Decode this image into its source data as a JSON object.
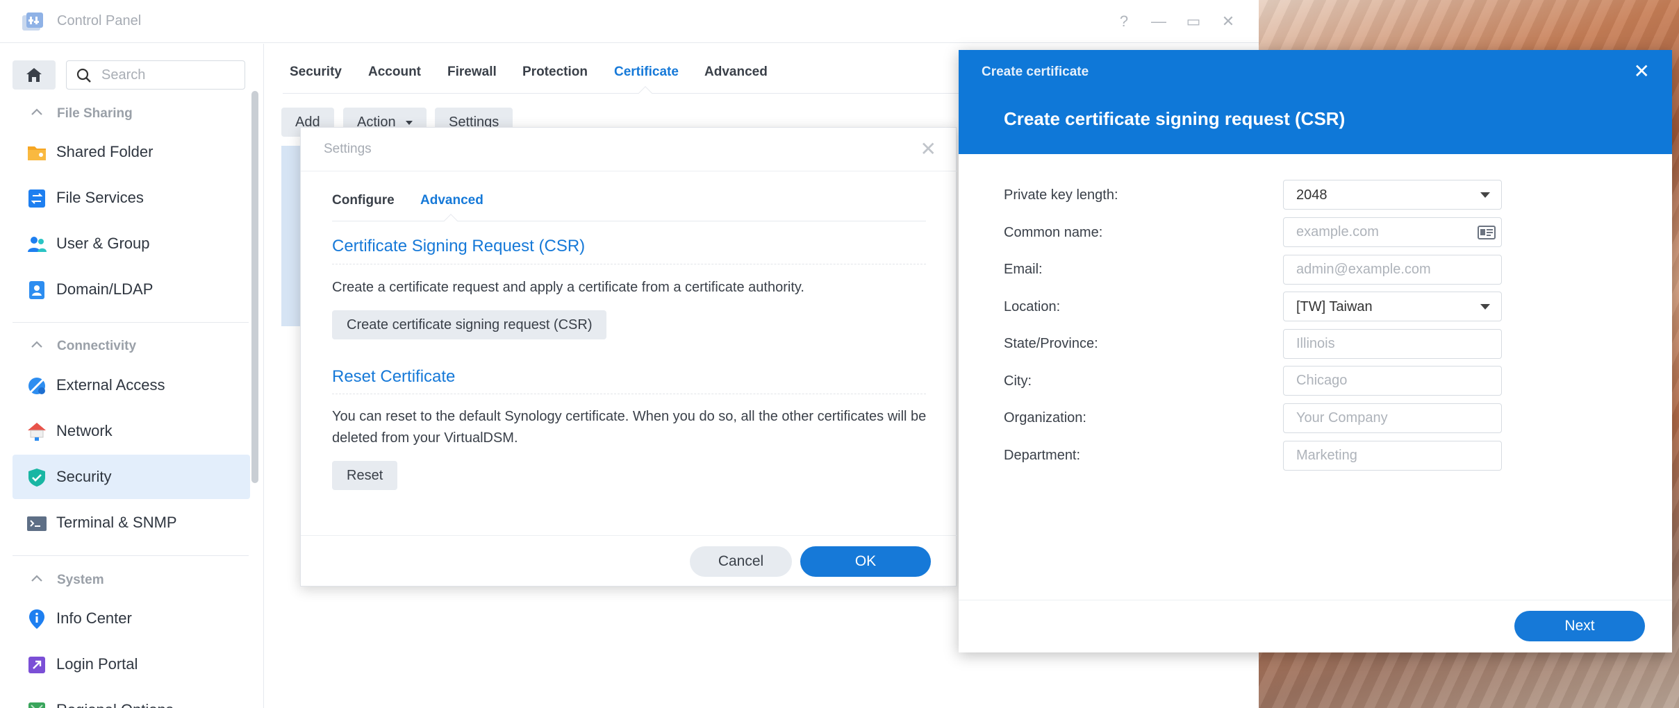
{
  "window": {
    "title": "Control Panel",
    "controls": {
      "help": "?",
      "minimize": "—",
      "maximize": "▭",
      "close": "✕"
    }
  },
  "sidebar": {
    "search_placeholder": "Search",
    "groups": [
      {
        "label": "File Sharing"
      },
      {
        "label": "Connectivity"
      },
      {
        "label": "System"
      }
    ],
    "items": [
      {
        "label": "Shared Folder",
        "icon": "shared-folder-icon"
      },
      {
        "label": "File Services",
        "icon": "file-services-icon"
      },
      {
        "label": "User & Group",
        "icon": "user-group-icon"
      },
      {
        "label": "Domain/LDAP",
        "icon": "domain-ldap-icon"
      },
      {
        "label": "External Access",
        "icon": "external-access-icon"
      },
      {
        "label": "Network",
        "icon": "network-icon"
      },
      {
        "label": "Security",
        "icon": "security-shield-icon",
        "active": true
      },
      {
        "label": "Terminal & SNMP",
        "icon": "terminal-icon"
      },
      {
        "label": "Info Center",
        "icon": "info-center-icon"
      },
      {
        "label": "Login Portal",
        "icon": "login-portal-icon"
      },
      {
        "label": "Regional Options",
        "icon": "regional-options-icon"
      }
    ]
  },
  "main": {
    "tabs": [
      {
        "label": "Security"
      },
      {
        "label": "Account"
      },
      {
        "label": "Firewall"
      },
      {
        "label": "Protection"
      },
      {
        "label": "Certificate",
        "active": true
      },
      {
        "label": "Advanced"
      }
    ],
    "toolbar": {
      "add": "Add",
      "action": "Action",
      "settings": "Settings"
    }
  },
  "settings_dialog": {
    "title": "Settings",
    "close": "✕",
    "tabs": [
      {
        "label": "Configure"
      },
      {
        "label": "Advanced",
        "active": true
      }
    ],
    "csr_heading": "Certificate Signing Request (CSR)",
    "csr_text": "Create a certificate request and apply a certificate from a certificate authority.",
    "csr_button": "Create certificate signing request (CSR)",
    "reset_heading": "Reset Certificate",
    "reset_text": "You can reset to the default Synology certificate. When you do so, all the other certificates will be deleted from your VirtualDSM.",
    "reset_button": "Reset",
    "cancel": "Cancel",
    "ok": "OK"
  },
  "cert_dialog": {
    "title": "Create certificate",
    "close": "✕",
    "heading": "Create certificate signing request (CSR)",
    "fields": {
      "key_length": {
        "label": "Private key length:",
        "value": "2048"
      },
      "common_name": {
        "label": "Common name:",
        "placeholder": "example.com"
      },
      "email": {
        "label": "Email:",
        "placeholder": "admin@example.com"
      },
      "location": {
        "label": "Location:",
        "value": "[TW] Taiwan"
      },
      "state": {
        "label": "State/Province:",
        "placeholder": "Illinois"
      },
      "city": {
        "label": "City:",
        "placeholder": "Chicago"
      },
      "organization": {
        "label": "Organization:",
        "placeholder": "Your Company"
      },
      "department": {
        "label": "Department:",
        "placeholder": "Marketing"
      }
    },
    "next": "Next"
  },
  "colors": {
    "accent": "#1679d8",
    "header_blue": "#0f78d8",
    "active_bg": "#e3eefb"
  }
}
